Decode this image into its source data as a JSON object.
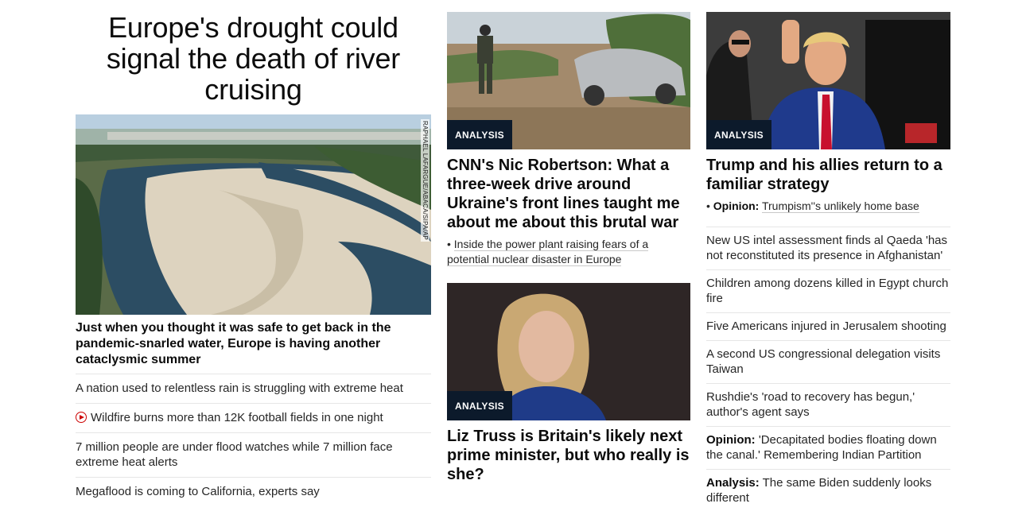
{
  "lead": {
    "title": "Europe's drought could signal the death of river cruising",
    "image_credit": "RAPHAEL LAFARGUE/ABACA/SIPA/AP",
    "headline": "Just when you thought it was safe to get back in the pandemic-snarled water, Europe is having another cataclysmic summer",
    "related": [
      {
        "text": "A nation used to relentless rain is struggling with extreme heat",
        "video": false
      },
      {
        "text": "Wildfire burns more than 12K football fields in one night",
        "video": true
      },
      {
        "text": "7 million people are under flood watches while 7 million face extreme heat alerts",
        "video": false
      },
      {
        "text": "Megaflood is coming to California, experts say",
        "video": false
      }
    ]
  },
  "middle": {
    "card1": {
      "badge": "ANALYSIS",
      "title": "CNN's Nic Robertson: What a three-week drive around Ukraine's front lines taught me about me about this brutal war",
      "sub": "Inside the power plant raising fears of a potential nuclear disaster in Europe"
    },
    "card2": {
      "badge": "ANALYSIS",
      "title": "Liz Truss is Britain's likely next prime minister, but who really is she?"
    }
  },
  "right": {
    "card": {
      "badge": "ANALYSIS",
      "title": "Trump and his allies return to a familiar strategy",
      "sub_prefix": "Opinion:",
      "sub": "Trumpism''s unlikely home base"
    },
    "list": [
      {
        "prefix": "",
        "text": "New US intel assessment finds al Qaeda 'has not reconstituted its presence in Afghanistan'"
      },
      {
        "prefix": "",
        "text": "Children among dozens killed in Egypt church fire"
      },
      {
        "prefix": "",
        "text": "Five Americans injured in Jerusalem shooting"
      },
      {
        "prefix": "",
        "text": "A second US congressional delegation visits Taiwan"
      },
      {
        "prefix": "",
        "text": "Rushdie's 'road to recovery has begun,' author's agent says"
      },
      {
        "prefix": "Opinion:",
        "text": "'Decapitated bodies floating down the canal.' Remembering Indian Partition"
      },
      {
        "prefix": "Analysis:",
        "text": "The same Biden suddenly looks different"
      }
    ]
  },
  "colors": {
    "badge_bg": "#0c1a2b",
    "video_red": "#cc0000"
  }
}
